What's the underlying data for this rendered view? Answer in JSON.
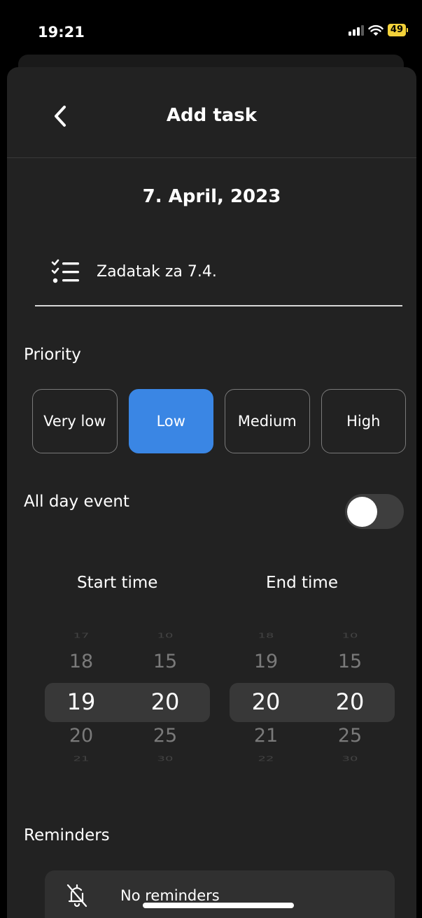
{
  "status_bar": {
    "time": "19:21",
    "battery": "49"
  },
  "nav": {
    "title": "Add task"
  },
  "date": "7. April, 2023",
  "task": {
    "value": "Zadatak za 7.4."
  },
  "priority": {
    "label": "Priority",
    "options": [
      "Very low",
      "Low",
      "Medium",
      "High"
    ],
    "selected": "Low"
  },
  "all_day": {
    "label": "All day event",
    "enabled": false
  },
  "start_time": {
    "label": "Start time",
    "hours": [
      "17",
      "18",
      "19",
      "20",
      "21"
    ],
    "minutes": [
      "10",
      "15",
      "20",
      "25",
      "30"
    ],
    "selected_hour": "19",
    "selected_minute": "20"
  },
  "end_time": {
    "label": "End time",
    "hours": [
      "18",
      "19",
      "20",
      "21",
      "22"
    ],
    "minutes": [
      "10",
      "15",
      "20",
      "25",
      "30"
    ],
    "selected_hour": "20",
    "selected_minute": "20"
  },
  "reminders": {
    "label": "Reminders",
    "empty_text": "No reminders"
  },
  "colors": {
    "accent": "#3a86e4",
    "sheet": "#222222",
    "card": "#303030",
    "battery": "#f3d23a"
  },
  "icons": {
    "back": "chevron-left-icon",
    "task": "checklist-icon",
    "reminder": "bell-off-icon"
  }
}
